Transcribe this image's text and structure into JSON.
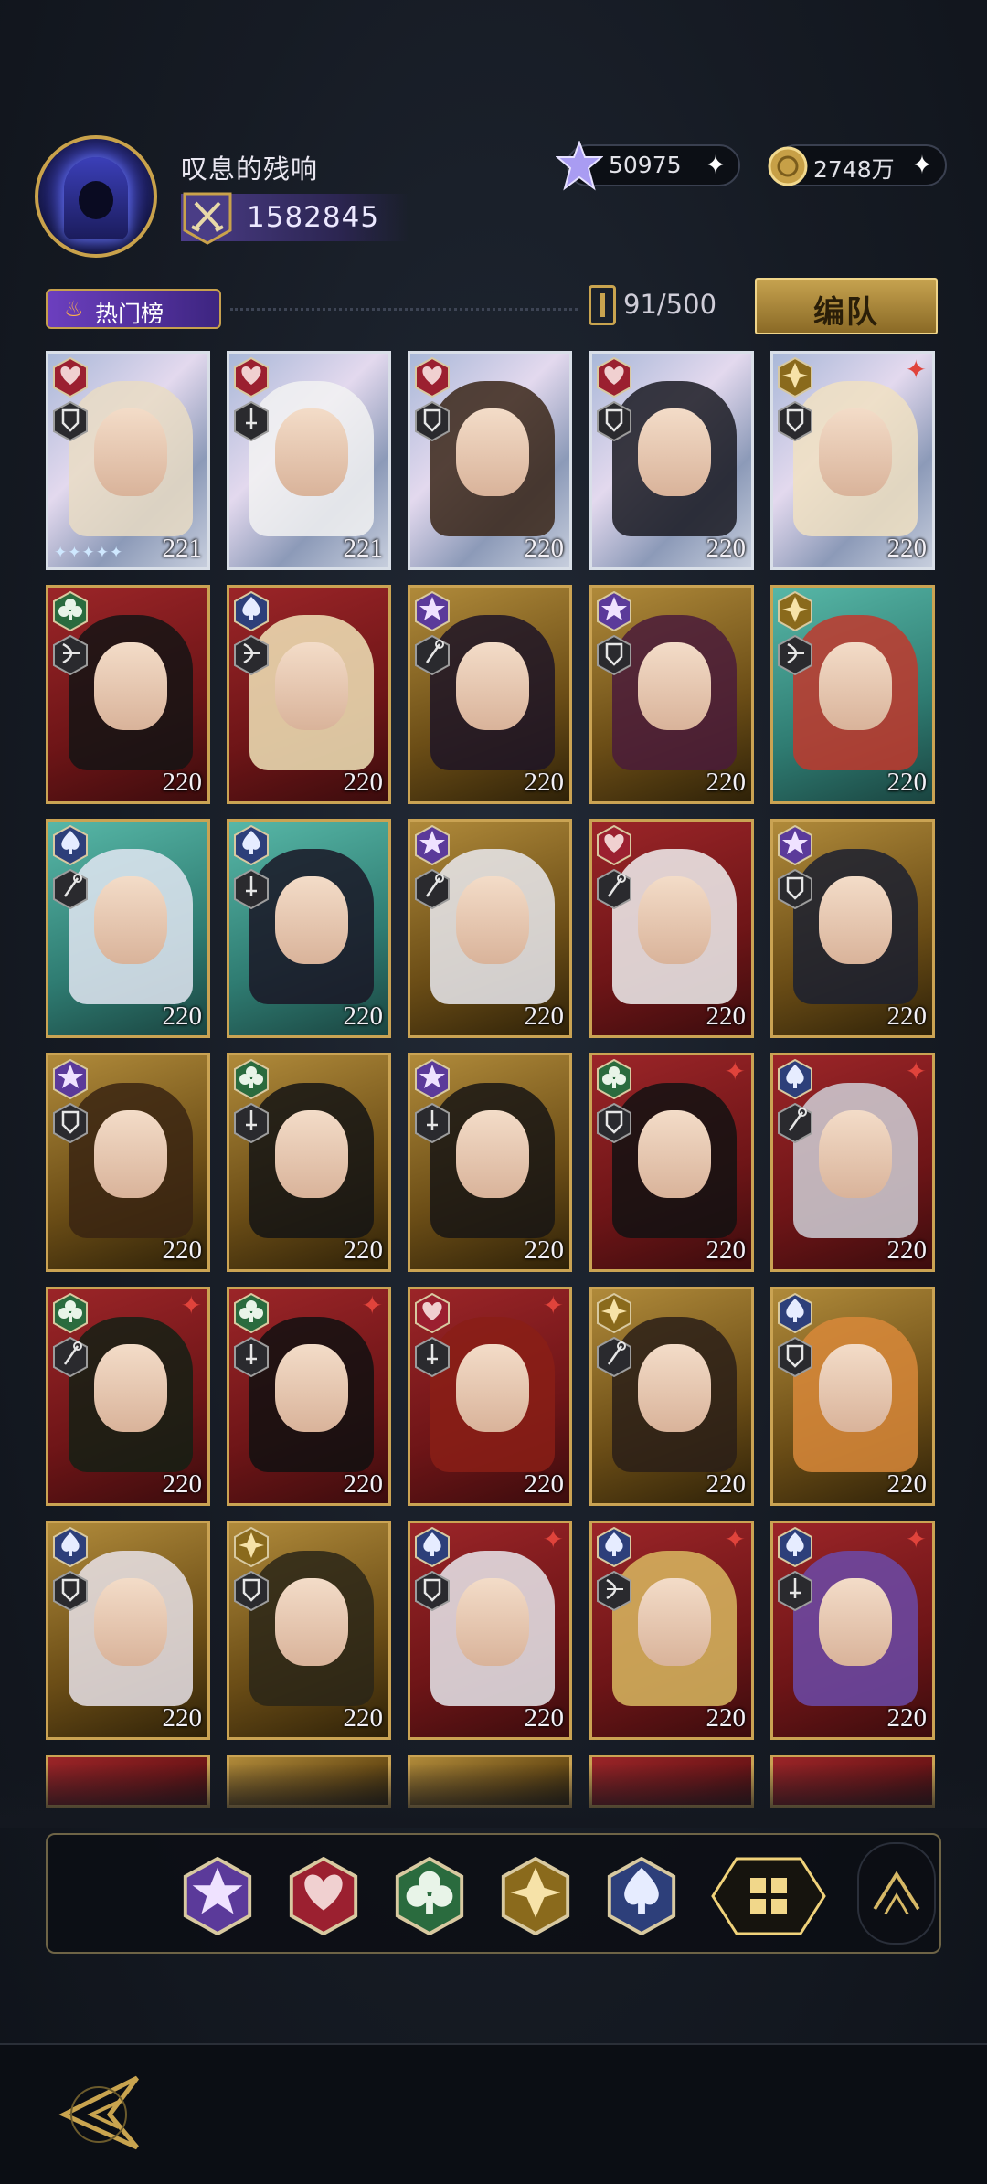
{
  "profile": {
    "username": "叹息的残响",
    "power": "1582845"
  },
  "currency": {
    "crystal": "50975",
    "gold": "2748万"
  },
  "toolbar": {
    "hot_label": "热门榜",
    "count": "91/500",
    "team_label": "编队"
  },
  "colors": {
    "gold": "#caa353",
    "red_bg": "#8e1f23",
    "teal_bg": "#3f9a8c",
    "gold_bg": "#8a6a26",
    "silver": "#d9dfe8"
  },
  "cards": [
    {
      "level": "221",
      "suit": "heart-icon",
      "cls": "shield-icon",
      "rank": false,
      "stars": "✦✦✦✦✦",
      "bg": "silver"
    },
    {
      "level": "221",
      "suit": "heart-icon",
      "cls": "sword-icon",
      "rank": false,
      "bg": "silver"
    },
    {
      "level": "220",
      "suit": "heart-icon",
      "cls": "shield-icon",
      "rank": false,
      "bg": "silver"
    },
    {
      "level": "220",
      "suit": "heart-icon",
      "cls": "shield-icon",
      "rank": false,
      "bg": "silver"
    },
    {
      "level": "220",
      "suit": "diamond-icon",
      "cls": "shield-icon",
      "rank": true,
      "bg": "silver"
    },
    {
      "level": "220",
      "suit": "club-icon",
      "cls": "bow-icon",
      "rank": false,
      "bg": "red"
    },
    {
      "level": "220",
      "suit": "spade-icon",
      "cls": "bow-icon",
      "rank": false,
      "bg": "red"
    },
    {
      "level": "220",
      "suit": "star-icon",
      "cls": "staff-icon",
      "rank": false,
      "bg": "gold"
    },
    {
      "level": "220",
      "suit": "star-icon",
      "cls": "shield-icon",
      "rank": false,
      "bg": "gold"
    },
    {
      "level": "220",
      "suit": "diamond-icon",
      "cls": "bow-icon",
      "rank": false,
      "bg": "teal"
    },
    {
      "level": "220",
      "suit": "spade-icon",
      "cls": "staff-icon",
      "rank": false,
      "bg": "teal"
    },
    {
      "level": "220",
      "suit": "spade-icon",
      "cls": "sword-icon",
      "rank": false,
      "bg": "teal"
    },
    {
      "level": "220",
      "suit": "star-icon",
      "cls": "staff-icon",
      "rank": false,
      "bg": "gold"
    },
    {
      "level": "220",
      "suit": "heart-icon",
      "cls": "staff-icon",
      "rank": false,
      "bg": "red"
    },
    {
      "level": "220",
      "suit": "star-icon",
      "cls": "shield-icon",
      "rank": false,
      "bg": "gold"
    },
    {
      "level": "220",
      "suit": "star-icon",
      "cls": "shield-icon",
      "rank": false,
      "bg": "gold"
    },
    {
      "level": "220",
      "suit": "club-icon",
      "cls": "sword-icon",
      "rank": false,
      "bg": "gold"
    },
    {
      "level": "220",
      "suit": "star-icon",
      "cls": "sword-icon",
      "rank": false,
      "bg": "gold"
    },
    {
      "level": "220",
      "suit": "club-icon",
      "cls": "shield-icon",
      "rank": true,
      "bg": "red"
    },
    {
      "level": "220",
      "suit": "spade-icon",
      "cls": "staff-icon",
      "rank": true,
      "bg": "red"
    },
    {
      "level": "220",
      "suit": "club-icon",
      "cls": "staff-icon",
      "rank": true,
      "bg": "red"
    },
    {
      "level": "220",
      "suit": "club-icon",
      "cls": "sword-icon",
      "rank": true,
      "bg": "red"
    },
    {
      "level": "220",
      "suit": "heart-icon",
      "cls": "sword-icon",
      "rank": true,
      "bg": "red"
    },
    {
      "level": "220",
      "suit": "diamond-icon",
      "cls": "staff-icon",
      "rank": false,
      "bg": "gold"
    },
    {
      "level": "220",
      "suit": "spade-icon",
      "cls": "shield-icon",
      "rank": false,
      "bg": "gold"
    },
    {
      "level": "220",
      "suit": "spade-icon",
      "cls": "shield-icon",
      "rank": false,
      "bg": "gold"
    },
    {
      "level": "220",
      "suit": "diamond-icon",
      "cls": "shield-icon",
      "rank": false,
      "bg": "gold"
    },
    {
      "level": "220",
      "suit": "spade-icon",
      "cls": "shield-icon",
      "rank": true,
      "bg": "red"
    },
    {
      "level": "220",
      "suit": "spade-icon",
      "cls": "bow-icon",
      "rank": true,
      "bg": "red"
    },
    {
      "level": "220",
      "suit": "spade-icon",
      "cls": "sword-icon",
      "rank": true,
      "bg": "red"
    }
  ],
  "filters": [
    {
      "name": "filter-star",
      "icon": "star-icon"
    },
    {
      "name": "filter-heart",
      "icon": "heart-icon"
    },
    {
      "name": "filter-club",
      "icon": "club-icon"
    },
    {
      "name": "filter-diamond",
      "icon": "diamond-icon"
    },
    {
      "name": "filter-spade",
      "icon": "spade-icon"
    },
    {
      "name": "filter-all",
      "icon": "grid-icon"
    }
  ]
}
